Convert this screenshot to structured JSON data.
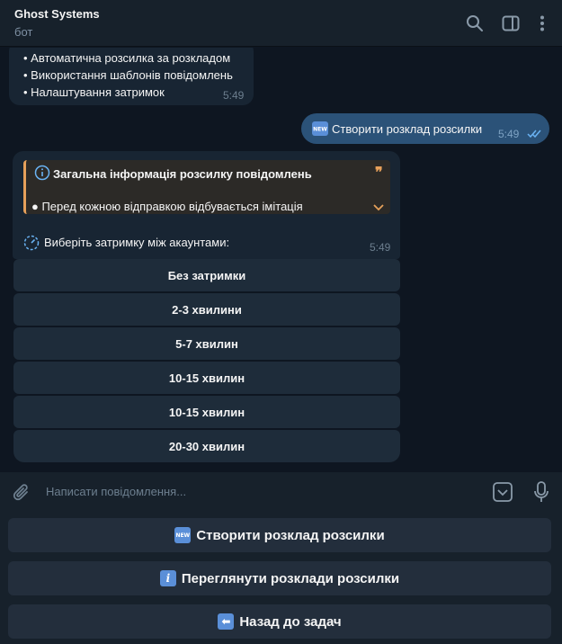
{
  "header": {
    "title": "Ghost Systems",
    "subtitle": "бот"
  },
  "messages": {
    "incoming_1": {
      "lines": [
        "• Автоматична розсилка за розкладом",
        "• Використання шаблонів повідомлень",
        "• Налаштування затримок"
      ],
      "time": "5:49"
    },
    "outgoing_1": {
      "badge": "NEW",
      "text": "Створити розклад розсилки",
      "time": "5:49"
    },
    "incoming_2": {
      "quote_title": "Загальна інформація розсилку повідомлень",
      "quote_mark": "❞",
      "quote_body": "● Перед кожною відправкою відбувається імітація",
      "prompt": "Виберіть затримку між акаунтами:",
      "time": "5:49"
    }
  },
  "inline_keyboard": [
    "Без затримки",
    "2-3 хвилини",
    "5-7 хвилин",
    "10-15 хвилин",
    "10-15 хвилин",
    "20-30 хвилин"
  ],
  "composer": {
    "placeholder": "Написати повідомлення..."
  },
  "reply_keyboard": {
    "create": {
      "badge": "NEW",
      "label": "Створити розклад розсилки"
    },
    "view": {
      "badge": "i",
      "label": "Переглянути розклади розсилки"
    },
    "back": {
      "badge": "⬅",
      "label": "Назад до задач"
    }
  },
  "colors": {
    "background": "#0e1621",
    "header": "#17212b",
    "incoming_bubble": "#182533",
    "outgoing_bubble": "#2b5278",
    "accent_quote": "#e6a05a"
  }
}
